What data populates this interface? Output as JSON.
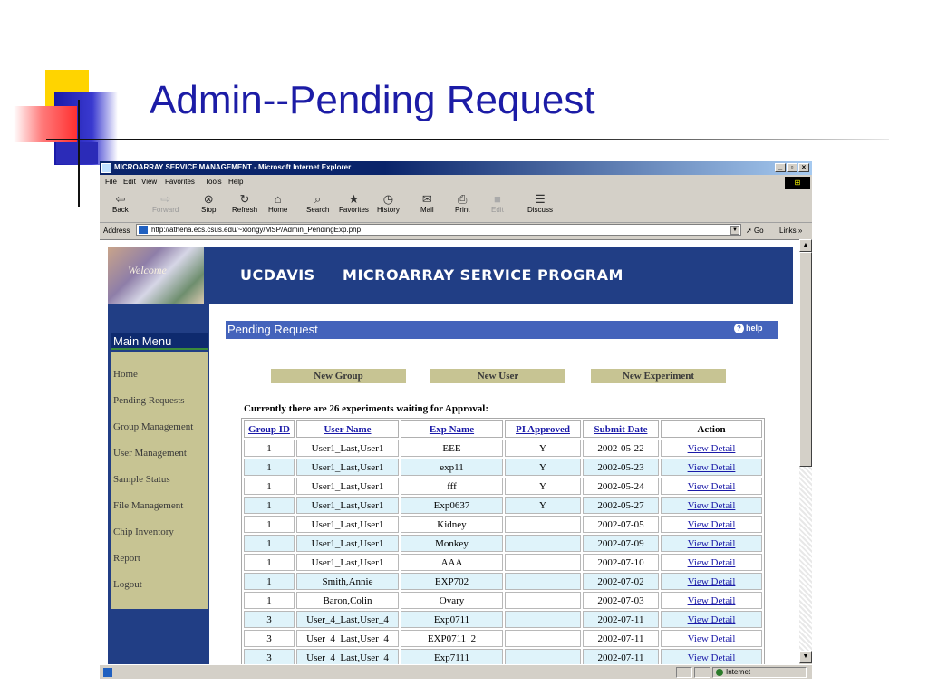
{
  "slide": {
    "title": "Admin--Pending Request"
  },
  "browser": {
    "window_title": "MICROARRAY SERVICE MANAGEMENT - Microsoft Internet Explorer",
    "menu": [
      "File",
      "Edit",
      "View",
      "Favorites",
      "Tools",
      "Help"
    ],
    "toolbar": [
      {
        "label": "Back",
        "icon": "back-arrow-icon",
        "enabled": true
      },
      {
        "label": "Forward",
        "icon": "forward-arrow-icon",
        "enabled": false
      },
      {
        "label": "Stop",
        "icon": "stop-icon",
        "enabled": true
      },
      {
        "label": "Refresh",
        "icon": "refresh-icon",
        "enabled": true
      },
      {
        "label": "Home",
        "icon": "home-icon",
        "enabled": true
      },
      {
        "label": "Search",
        "icon": "search-icon",
        "enabled": true
      },
      {
        "label": "Favorites",
        "icon": "favorites-icon",
        "enabled": true
      },
      {
        "label": "History",
        "icon": "history-icon",
        "enabled": true
      },
      {
        "label": "Mail",
        "icon": "mail-icon",
        "enabled": true
      },
      {
        "label": "Print",
        "icon": "print-icon",
        "enabled": true
      },
      {
        "label": "Edit",
        "icon": "edit-icon",
        "enabled": false
      },
      {
        "label": "Discuss",
        "icon": "discuss-icon",
        "enabled": true
      }
    ],
    "address_label": "Address",
    "address_url": "http://athena.ecs.csus.edu/~xiongy/MSP/Admin_PendingExp.php",
    "go_label": "Go",
    "links_label": "Links »",
    "status_zone": "Internet"
  },
  "page": {
    "banner_photo_text": "Welcome",
    "banner_title": "UCDAVIS     MICROARRAY SERVICE PROGRAM",
    "main_menu_title": "Main Menu",
    "menu_items": [
      "Home",
      "Pending Requests",
      "Group Management",
      "User Management",
      "Sample Status",
      "File Management",
      "Chip Inventory",
      "Report",
      "Logout"
    ],
    "section_title": "Pending Request",
    "help_label": "help",
    "buttons": {
      "new_group": "New Group",
      "new_user": "New User",
      "new_experiment": "New Experiment"
    },
    "summary": "Currently there are 26 experiments waiting for Approval:",
    "table": {
      "headers": [
        "Group ID",
        "User Name",
        "Exp Name",
        "PI Approved",
        "Submit Date",
        "Action"
      ],
      "rows": [
        [
          "1",
          "User1_Last,User1",
          "EEE",
          "Y",
          "2002-05-22",
          "View Detail"
        ],
        [
          "1",
          "User1_Last,User1",
          "exp11",
          "Y",
          "2002-05-23",
          "View Detail"
        ],
        [
          "1",
          "User1_Last,User1",
          "fff",
          "Y",
          "2002-05-24",
          "View Detail"
        ],
        [
          "1",
          "User1_Last,User1",
          "Exp0637",
          "Y",
          "2002-05-27",
          "View Detail"
        ],
        [
          "1",
          "User1_Last,User1",
          "Kidney",
          "",
          "2002-07-05",
          "View Detail"
        ],
        [
          "1",
          "User1_Last,User1",
          "Monkey",
          "",
          "2002-07-09",
          "View Detail"
        ],
        [
          "1",
          "User1_Last,User1",
          "AAA",
          "",
          "2002-07-10",
          "View Detail"
        ],
        [
          "1",
          "Smith,Annie",
          "EXP702",
          "",
          "2002-07-02",
          "View Detail"
        ],
        [
          "1",
          "Baron,Colin",
          "Ovary",
          "",
          "2002-07-03",
          "View Detail"
        ],
        [
          "3",
          "User_4_Last,User_4",
          "Exp0711",
          "",
          "2002-07-11",
          "View Detail"
        ],
        [
          "3",
          "User_4_Last,User_4",
          "EXP0711_2",
          "",
          "2002-07-11",
          "View Detail"
        ],
        [
          "3",
          "User_4_Last,User_4",
          "Exp7111",
          "",
          "2002-07-11",
          "View Detail"
        ]
      ]
    }
  }
}
